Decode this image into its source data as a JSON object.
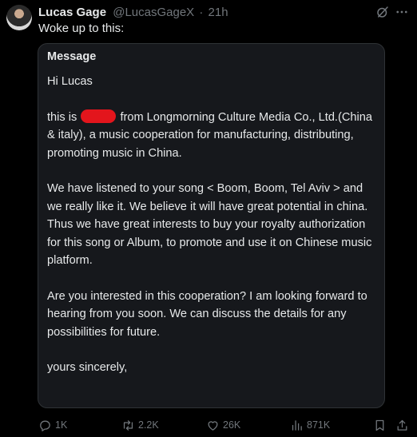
{
  "author": {
    "display_name": "Lucas Gage",
    "handle": "@LucasGageX",
    "separator": "·",
    "time": "21h"
  },
  "tweet": {
    "text": "Woke up to this:"
  },
  "message": {
    "title": "Message",
    "greeting": "Hi Lucas",
    "intro_before": "this is",
    "intro_after": "from Longmorning Culture Media Co., Ltd.(China & italy), a music cooperation for manufacturing, distributing, promoting music in China.",
    "paragraph_2": "We have listened to your song < Boom, Boom, Tel Aviv > and we really like it. We believe it will have great potential in china. Thus we have great interests to buy your royalty authorization for this song or Album, to promote and use it on Chinese music platform.",
    "paragraph_3": "Are you interested in this cooperation? I am looking forward to hearing from you soon. We can discuss the details for any possibilities for future.",
    "closing": "yours sincerely,"
  },
  "actions": {
    "replies": "1K",
    "reposts": "2.2K",
    "likes": "26K",
    "views": "871K"
  },
  "colors": {
    "background": "#000000",
    "card_background": "#16181c",
    "text_primary": "#e7e9ea",
    "text_secondary": "#71767b",
    "redaction": "#e3151c"
  },
  "icons": {
    "grok": "grok-icon",
    "more": "more-icon",
    "reply": "reply-icon",
    "repost": "repost-icon",
    "like": "heart-icon",
    "views": "views-icon",
    "bookmark": "bookmark-icon",
    "share": "share-icon"
  }
}
